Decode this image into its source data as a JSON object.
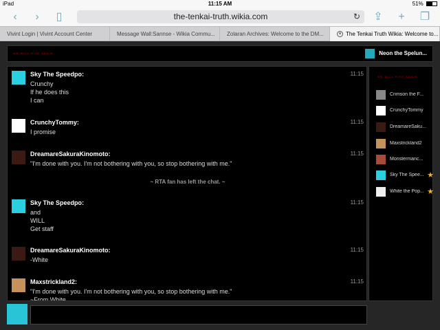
{
  "status": {
    "carrier": "iPad",
    "time": "11:15 AM",
    "battery": "51%"
  },
  "browser": {
    "url": "the-tenkai-truth.wikia.com",
    "tabs": [
      {
        "label": "Vivint Login  |  Vivint Account Center"
      },
      {
        "label": "Message Wall:Sannse - Wikia Commu..."
      },
      {
        "label": "Zolaran Archives: Welcome to the DM..."
      },
      {
        "label": "The Tenkai Truth Wikia: Welcome to..."
      }
    ]
  },
  "header": {
    "logo_text": "WE WILL RISE AGAIN",
    "room_user": "Neon the Spelun..."
  },
  "messages": [
    {
      "name": "Sky The Speedpo:",
      "time": "11:15",
      "lines": [
        "Crunchy",
        "If he does this",
        "I can"
      ],
      "avatar": "cyan"
    },
    {
      "name": "CrunchyTommy:",
      "time": "11:15",
      "lines": [
        "I promise"
      ],
      "avatar": "white"
    },
    {
      "name": "DreamareSakuraKinomoto:",
      "time": "11:15",
      "lines": [
        "\"I'm done with you. I'm not bothering with you, so stop bothering with me.\""
      ],
      "avatar": "dark"
    },
    {
      "name": "Sky The Speedpo:",
      "time": "11:15",
      "lines": [
        "and",
        "WILL",
        "Get staff"
      ],
      "avatar": "cyan"
    },
    {
      "name": "DreamareSakuraKinomoto:",
      "time": "11:15",
      "lines": [
        "-White"
      ],
      "avatar": "dark"
    },
    {
      "name": "Maxstrickland2:",
      "time": "11:15",
      "lines": [
        "\"I'm done with you. I'm not bothering with you, so stop bothering with me.\"",
        "~From White"
      ],
      "avatar": "tan"
    }
  ],
  "left_note": "~ RTA fan has left the chat. ~",
  "sidebar": {
    "users": [
      {
        "name": "Crimson the F...",
        "star": ""
      },
      {
        "name": "CrunchyTommy",
        "star": ""
      },
      {
        "name": "DreamareSaku...",
        "star": ""
      },
      {
        "name": "Maxstrickland2",
        "star": ""
      },
      {
        "name": "Monstermanc...",
        "star": ""
      },
      {
        "name": "Sky The Spee...",
        "star": "★"
      },
      {
        "name": "White the Pop...",
        "star": "★"
      }
    ]
  },
  "icons": {
    "back": "chevron-left-icon",
    "forward": "chevron-right-icon",
    "bookmarks": "book-icon",
    "reload": "reload-icon",
    "share": "share-icon",
    "new_tab": "plus-icon",
    "tabs": "tabs-icon"
  }
}
